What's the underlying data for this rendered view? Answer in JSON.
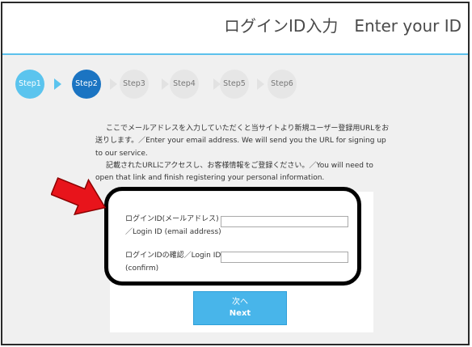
{
  "header": {
    "title": "ログインID入力　Enter your ID"
  },
  "steps": [
    {
      "label": "Step1",
      "state": "done"
    },
    {
      "label": "Step2",
      "state": "active"
    },
    {
      "label": "Step3",
      "state": "pending"
    },
    {
      "label": "Step4",
      "state": "pending"
    },
    {
      "label": "Step5",
      "state": "pending"
    },
    {
      "label": "Step6",
      "state": "pending"
    }
  ],
  "intro": {
    "line1": "ここでメールアドレスを入力していただくと当サイトより新規ユーザー登録用URLをお送りします。／Enter your email address. We will send you the URL for signing up to our service.",
    "line2": "記載されたURLにアクセスし、お客様情報をご登録ください。／You will need to open that link and finish registering your personal information."
  },
  "form": {
    "login_id_label_ja": "ログインID(メールアドレス)",
    "login_id_label_en": "／Login ID (email address)",
    "login_id_value": "",
    "confirm_label_ja": "ログインIDの確認／Login ID",
    "confirm_label_en": "(confirm)",
    "confirm_value": ""
  },
  "next_button": {
    "label_ja": "次へ",
    "label_en": "Next"
  },
  "colors": {
    "step_done": "#5bc4ee",
    "step_active": "#1b74c2",
    "step_pending": "#e6e6e6",
    "button": "#48b5ea",
    "highlight_arrow": "#e8141b"
  },
  "annotation": {
    "arrow_icon": "red-arrow-icon",
    "highlight": "black-rounded-box"
  }
}
